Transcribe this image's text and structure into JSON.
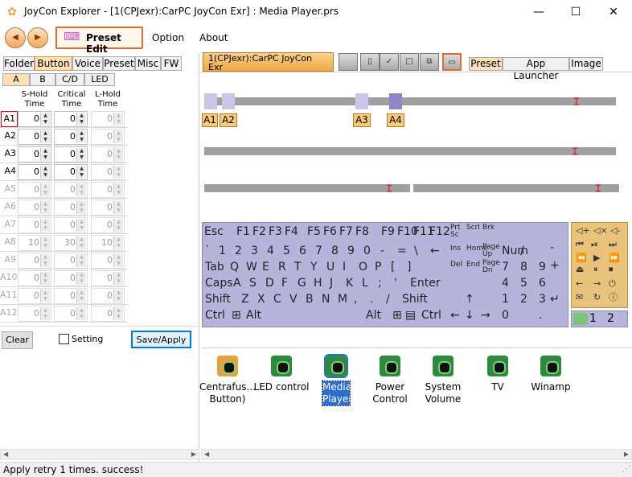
{
  "window": {
    "title": "JoyCon Explorer - [1(CPJexr):CarPC JoyCon Exr] : Media Player.prs",
    "minimize": "—",
    "maximize": "☐",
    "close": "✕"
  },
  "menu": {
    "back": "◀",
    "forward": "▶",
    "preset_edit": "Preset Edit",
    "option": "Option",
    "about": "About"
  },
  "left_tabs": [
    "Folder",
    "Button",
    "Voice",
    "Preset",
    "Misc",
    "FW"
  ],
  "sub_tabs": [
    "A",
    "B",
    "C/D",
    "LED"
  ],
  "columns": [
    "S-Hold\nTime",
    "Critical\nTime",
    "L-Hold\nTime"
  ],
  "rows": [
    {
      "label": "A1",
      "s": "0",
      "c": "0",
      "l": "0"
    },
    {
      "label": "A2",
      "s": "0",
      "c": "0",
      "l": "0"
    },
    {
      "label": "A3",
      "s": "0",
      "c": "0",
      "l": "0"
    },
    {
      "label": "A4",
      "s": "0",
      "c": "0",
      "l": "0"
    },
    {
      "label": "A5",
      "s": "0",
      "c": "0",
      "l": "0"
    },
    {
      "label": "A6",
      "s": "0",
      "c": "0",
      "l": "0"
    },
    {
      "label": "A7",
      "s": "0",
      "c": "0",
      "l": "0"
    },
    {
      "label": "A8",
      "s": "10",
      "c": "30",
      "l": "10"
    },
    {
      "label": "A9",
      "s": "0",
      "c": "0",
      "l": "0"
    },
    {
      "label": "A10",
      "s": "0",
      "c": "0",
      "l": "0"
    },
    {
      "label": "A11",
      "s": "0",
      "c": "0",
      "l": "0"
    },
    {
      "label": "A12",
      "s": "0",
      "c": "0",
      "l": "0"
    }
  ],
  "buttons": {
    "clear": "Clear",
    "setting": "Setting",
    "save": "Save/Apply"
  },
  "doc_tab": {
    "line1": "1(CPJexr):CarPC JoyCon Exr",
    "line2": "Media Player"
  },
  "right_tabs": [
    "Preset",
    "App Launcher",
    "Image"
  ],
  "axis_labels": [
    "A1",
    "A2",
    "A3",
    "A4"
  ],
  "keyboard": {
    "row1": [
      "Esc",
      "F1",
      "F2",
      "F3",
      "F4",
      "F5",
      "F6",
      "F7",
      "F8",
      "F9",
      "F10",
      "F11",
      "F12"
    ],
    "prtsc": "Prt\nSc",
    "scrl": "Scrl",
    "brk": "Brk",
    "row2": [
      "`",
      "1",
      "2",
      "3",
      "4",
      "5",
      "6",
      "7",
      "8",
      "9",
      "0",
      "-",
      "=",
      "\\",
      "←"
    ],
    "ins": "Ins",
    "home": "Home",
    "pgup": "Page\nUp",
    "num": "Num",
    "slash": "/",
    "minus": "-",
    "row3": [
      "Tab",
      "Q",
      "W",
      "E",
      "R",
      "T",
      "Y",
      "U",
      "I",
      "O",
      "P",
      "[",
      "]"
    ],
    "del": "Del",
    "end": "End",
    "pgdn": "Page\nDn",
    "row4": [
      "Caps",
      "A",
      "S",
      "D",
      "F",
      "G",
      "H",
      "J",
      "K",
      "L",
      ";",
      "'",
      "Enter"
    ],
    "row5": [
      "Shift",
      "Z",
      "X",
      "C",
      "V",
      "B",
      "N",
      "M",
      ",",
      ".",
      "/",
      "Shift"
    ],
    "row6": [
      "Ctrl",
      "⊞",
      "Alt",
      "Alt",
      "⊞",
      "▤",
      "Ctrl"
    ],
    "arrows": [
      "↑",
      "←",
      "↓",
      "→"
    ],
    "numpad": [
      "7",
      "8",
      "9",
      "+",
      "4",
      "5",
      "6",
      "1",
      "2",
      "3",
      "↵",
      "0",
      "."
    ]
  },
  "pages": [
    "1",
    "2"
  ],
  "icons": [
    {
      "label": "Centrafus...\nButton)"
    },
    {
      "label": "LED control"
    },
    {
      "label": "Media\nPlayer"
    },
    {
      "label": "Power\nControl"
    },
    {
      "label": "System\nVolume"
    },
    {
      "label": "TV"
    },
    {
      "label": "Winamp"
    }
  ],
  "status": "Apply retry  1 times. success!"
}
